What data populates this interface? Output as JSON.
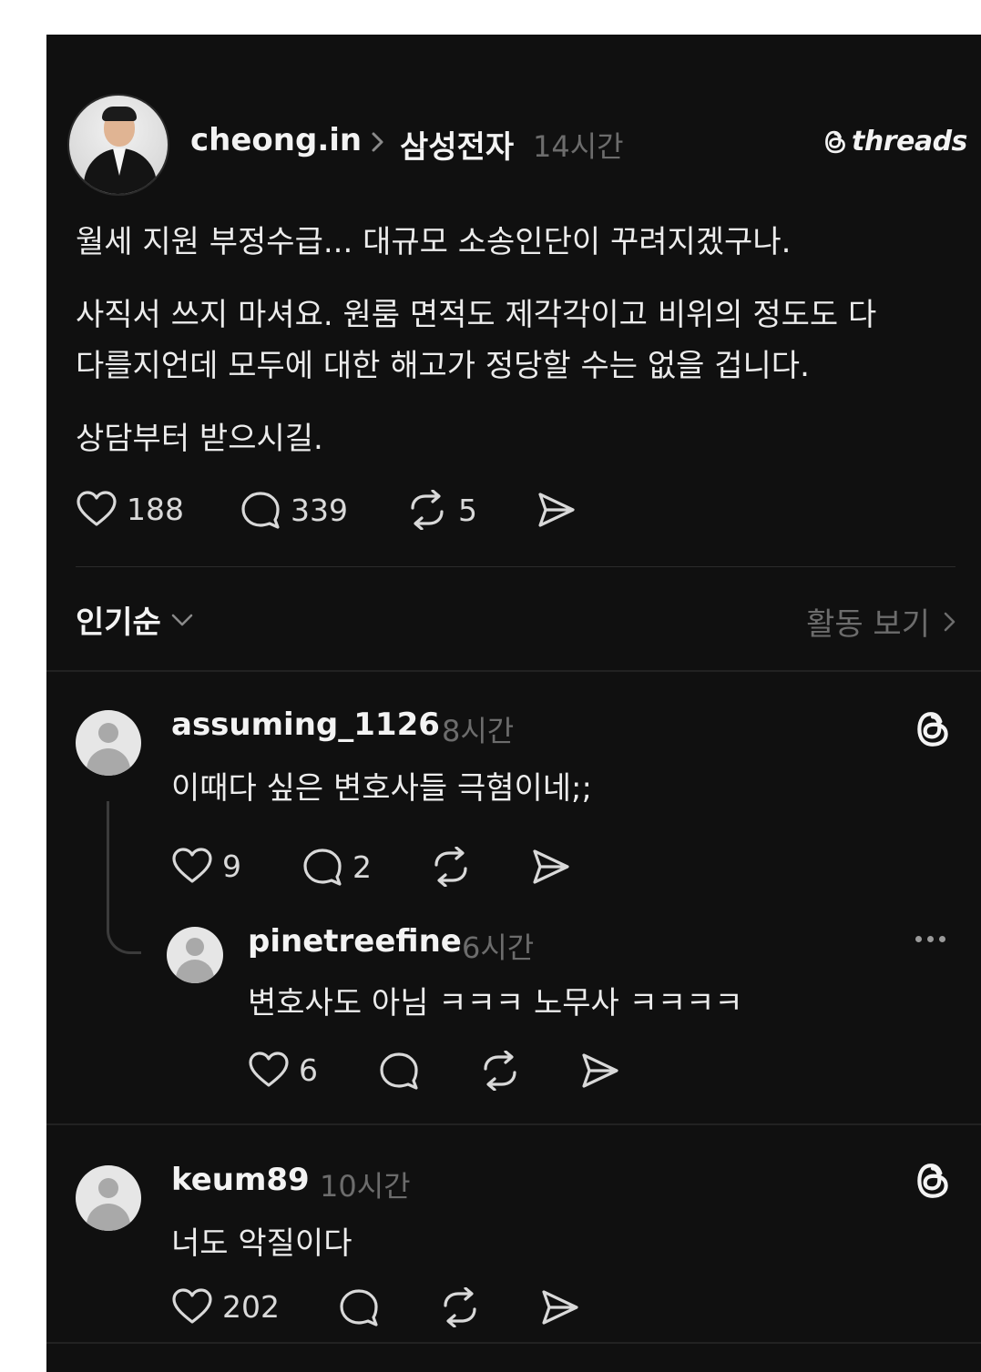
{
  "post": {
    "author": "cheong.in",
    "topic": "삼성전자",
    "time": "14시간",
    "brand": "threads",
    "paragraphs": [
      "월세 지원 부정수급... 대규모 소송인단이 꾸려지겠구나.",
      "사직서 쓰지 마셔요. 원룸 면적도 제각각이고 비위의 정도도 다",
      "다를지언데 모두에 대한 해고가 정당할 수는 없을 겁니다.",
      "상담부터 받으시길."
    ],
    "likes": "188",
    "comments": "339",
    "reposts": "5"
  },
  "sort": {
    "label": "인기순",
    "activity_label": "활동 보기"
  },
  "replies": [
    {
      "username": "assuming_1126",
      "time": "8시간",
      "text": "이때다 싶은 변호사들 극혐이네;;",
      "likes": "9",
      "comments": "2",
      "nested": {
        "username": "pinetreefine",
        "time": "6시간",
        "text": "변호사도 아님 ㅋㅋㅋ 노무사 ㅋㅋㅋㅋ",
        "likes": "6"
      }
    },
    {
      "username": "keum89",
      "time": "10시간",
      "text": "너도 악질이다",
      "likes": "202"
    }
  ],
  "icons": {
    "like": "heart-icon",
    "comment": "comment-bubble-icon",
    "repost": "repost-icon",
    "share": "send-icon",
    "threads": "threads-logo-icon",
    "more": "more-dots-icon",
    "chevron": "chevron-icon"
  }
}
